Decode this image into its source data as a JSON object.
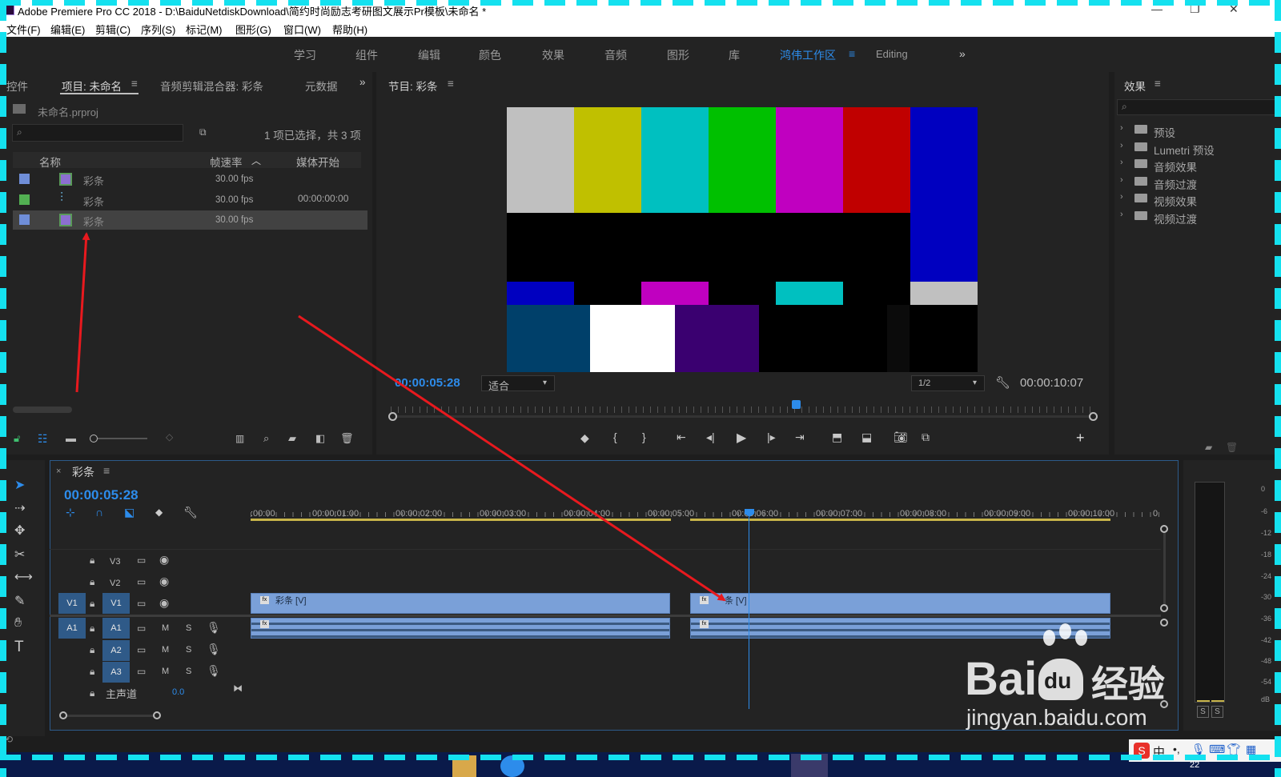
{
  "window": {
    "title": "Adobe Premiere Pro CC 2018 - D:\\BaiduNetdiskDownload\\简约时尚励志考研图文展示Pr模板\\未命名 *"
  },
  "menu": [
    "文件(F)",
    "编辑(E)",
    "剪辑(C)",
    "序列(S)",
    "标记(M)",
    "图形(G)",
    "窗口(W)",
    "帮助(H)"
  ],
  "workspaces": {
    "items": [
      "学习",
      "组件",
      "编辑",
      "颜色",
      "效果",
      "音频",
      "图形",
      "库",
      "鸿伟工作区",
      "Editing"
    ],
    "active": "鸿伟工作区"
  },
  "project_panel": {
    "tabs": [
      "控件",
      "项目: 未命名",
      "音频剪辑混合器: 彩条",
      "元数据"
    ],
    "file": "未命名.prproj",
    "search_placeholder": "",
    "selection_info": "1 项已选择，共 3 项",
    "columns": [
      "名称",
      "帧速率",
      "媒体开始"
    ],
    "rows": [
      {
        "name": "彩条",
        "fps": "30.00 fps",
        "start": "",
        "color": "#6f8ed8"
      },
      {
        "name": "彩条",
        "fps": "30.00 fps",
        "start": "00:00:00:00",
        "color": "#52b052"
      },
      {
        "name": "彩条",
        "fps": "30.00 fps",
        "start": "",
        "color": "#6f8ed8"
      }
    ]
  },
  "program_monitor": {
    "title": "节目: 彩条",
    "current_time": "00:00:05:28",
    "fit": "适合",
    "resolution": "1/2",
    "duration": "00:00:10:07"
  },
  "effects_panel": {
    "title": "效果",
    "items": [
      "预设",
      "Lumetri 预设",
      "音频效果",
      "音频过渡",
      "视频效果",
      "视频过渡"
    ]
  },
  "timeline": {
    "sequence": "彩条",
    "timecode": "00:00:05:28",
    "ruler": [
      ":00:00",
      "00:00:01:00",
      "00:00:02:00",
      "00:00:03:00",
      "00:00:04:00",
      "00:00:05:00",
      "00:00:06:00",
      "00:00:07:00",
      "00:00:08:00",
      "00:00:09:00",
      "00:00:10:00",
      "0"
    ],
    "video_tracks": [
      "V3",
      "V2",
      "V1"
    ],
    "audio_tracks": [
      "A1",
      "A2",
      "A3"
    ],
    "source_v": "V1",
    "source_a": "A1",
    "master_label": "主声道",
    "master_value": "0.0",
    "clip_label": "彩条 [V]",
    "clip_label_2": "条 [V]",
    "mute_label": "M",
    "solo_label": "S",
    "fx_label": "fx"
  },
  "meters": {
    "labels": [
      "0",
      "-6",
      "-12",
      "-18",
      "-24",
      "-30",
      "-36",
      "-42",
      "-48",
      "-54",
      "dB"
    ],
    "solo_left": "S",
    "solo_right": "S"
  },
  "watermark": {
    "brand_left": "Bai",
    "brand_mid": "du",
    "brand_right": "经验",
    "url": "jingyan.baidu.com"
  },
  "taskbar": {
    "ime": "中",
    "clock": "22"
  },
  "colors": {
    "accent": "#2d8ceb",
    "annotation": "#e8191e",
    "frame": "#14e1ef"
  }
}
